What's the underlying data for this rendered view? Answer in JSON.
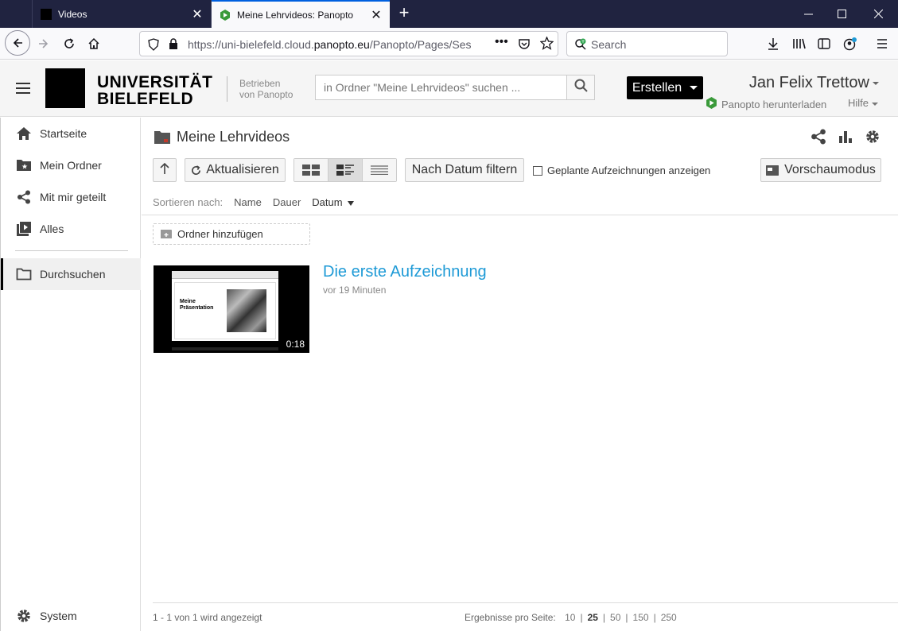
{
  "browser": {
    "tabs": [
      {
        "label": "Videos",
        "active": false
      },
      {
        "label": "Meine Lehrvideos: Panopto",
        "active": true
      }
    ],
    "url_domain_prefix": "https://uni-bielefeld.cloud.",
    "url_domain": "panopto.eu",
    "url_path": "/Panopto/Pages/Ses",
    "search_placeholder": "Search"
  },
  "header": {
    "logo_line1": "UNIVERSITÄT",
    "logo_line2": "BIELEFELD",
    "powered_line1": "Betrieben",
    "powered_line2": "von Panopto",
    "search_placeholder": "in Ordner \"Meine Lehrvideos\" suchen ...",
    "create_label": "Erstellen",
    "user_name": "Jan Felix Trettow",
    "download_label": "Panopto herunterladen",
    "help_label": "Hilfe"
  },
  "sidebar": {
    "items": [
      {
        "label": "Startseite"
      },
      {
        "label": "Mein Ordner"
      },
      {
        "label": "Mit mir geteilt"
      },
      {
        "label": "Alles"
      },
      {
        "label": "Durchsuchen"
      },
      {
        "label": "System"
      }
    ]
  },
  "main": {
    "folder_title": "Meine Lehrvideos",
    "refresh_label": "Aktualisieren",
    "date_filter_label": "Nach Datum filtern",
    "scheduled_label": "Geplante Aufzeichnungen anzeigen",
    "preview_label": "Vorschaumodus",
    "sort_prefix": "Sortieren nach:",
    "sort_options": [
      "Name",
      "Dauer",
      "Datum"
    ],
    "add_folder_label": "Ordner hinzufügen",
    "video": {
      "title": "Die erste Aufzeichnung",
      "meta": "vor 19 Minuten",
      "duration": "0:18",
      "thumb_text_line1": "Meine",
      "thumb_text_line2": "Präsentation"
    },
    "results_text": "1 - 1 von 1 wird angezeigt",
    "per_page_label": "Ergebnisse pro Seite:",
    "per_page_options": [
      "10",
      "25",
      "50",
      "150",
      "250"
    ],
    "per_page_selected": "25"
  },
  "colors": {
    "accent_link": "#1e9ad6",
    "tab_bar": "#202340",
    "create_button": "#000000"
  }
}
